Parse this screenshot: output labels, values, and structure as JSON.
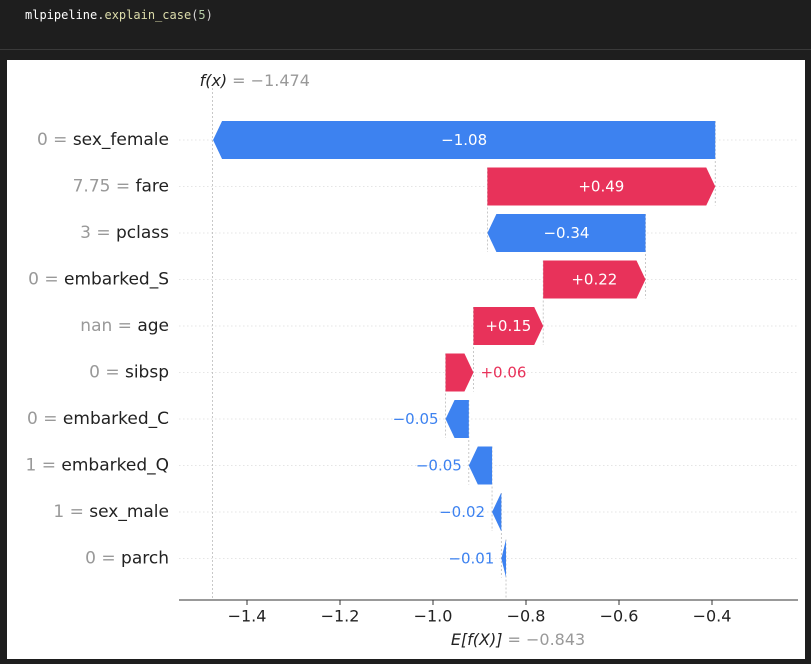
{
  "cell": {
    "code_object": "mlpipeline",
    "code_dot": ".",
    "code_function": "explain_case",
    "code_open": "(",
    "code_arg": "5",
    "code_close": ")"
  },
  "chart_data": {
    "type": "waterfall",
    "fx_label": "f(x)",
    "fx_value_text": "= −1.474",
    "fx_value": -1.474,
    "base_label": "E[f(X)]",
    "base_value_text": "= −0.843",
    "base_value": -0.843,
    "xlim": [
      -1.57,
      -0.24
    ],
    "xticks": [
      -1.4,
      -1.2,
      -1.0,
      -0.8,
      -0.6,
      -0.4
    ],
    "xtick_labels": [
      "−1.4",
      "−1.2",
      "−1.0",
      "−0.8",
      "−0.6",
      "−0.4"
    ],
    "colors": {
      "positive": "#e8325a",
      "negative": "#3d82f0",
      "feature_value": "#999999",
      "feature_name": "#222222"
    },
    "features": [
      {
        "value_text": "0",
        "name": "sex_female",
        "contribution": -1.08,
        "label": "−1.08"
      },
      {
        "value_text": "7.75",
        "name": "fare",
        "contribution": 0.49,
        "label": "+0.49"
      },
      {
        "value_text": "3",
        "name": "pclass",
        "contribution": -0.34,
        "label": "−0.34"
      },
      {
        "value_text": "0",
        "name": "embarked_S",
        "contribution": 0.22,
        "label": "+0.22"
      },
      {
        "value_text": "nan",
        "name": "age",
        "contribution": 0.15,
        "label": "+0.15"
      },
      {
        "value_text": "0",
        "name": "sibsp",
        "contribution": 0.06,
        "label": "+0.06"
      },
      {
        "value_text": "0",
        "name": "embarked_C",
        "contribution": -0.05,
        "label": "−0.05"
      },
      {
        "value_text": "1",
        "name": "embarked_Q",
        "contribution": -0.05,
        "label": "−0.05"
      },
      {
        "value_text": "1",
        "name": "sex_male",
        "contribution": -0.02,
        "label": "−0.02"
      },
      {
        "value_text": "0",
        "name": "parch",
        "contribution": -0.01,
        "label": "−0.01"
      }
    ]
  }
}
